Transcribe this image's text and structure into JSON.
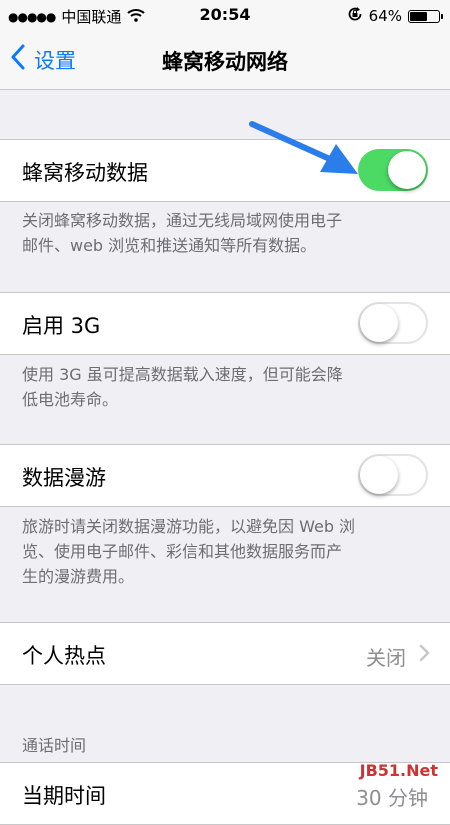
{
  "status_bar": {
    "signal": "●●●●●",
    "carrier": "中国联通",
    "time": "20:54",
    "battery_pct": "64%",
    "battery_level": 0.64
  },
  "nav": {
    "back_label": "设置",
    "title": "蜂窝移动网络"
  },
  "rows": {
    "cellular_data": {
      "label": "蜂窝移动数据",
      "enabled": true,
      "footer_line1": "关闭蜂窝移动数据，通过无线局域网使用电子",
      "footer_line2": "邮件、web 浏览和推送通知等所有数据。"
    },
    "enable_3g": {
      "label": "启用 3G",
      "enabled": false,
      "footer_line1": "使用 3G 虽可提高数据载入速度，但可能会降",
      "footer_line2": "低电池寿命。"
    },
    "data_roaming": {
      "label": "数据漫游",
      "enabled": false,
      "footer_line1": "旅游时请关闭数据漫游功能，以避免因 Web 浏",
      "footer_line2": "览、使用电子邮件、彩信和其他数据服务而产",
      "footer_line3": "生的漫游费用。"
    },
    "hotspot": {
      "label": "个人热点",
      "value": "关闭"
    }
  },
  "call_time": {
    "header": "通话时间",
    "current_period_label": "当期时间",
    "current_period_value": "30 分钟"
  },
  "watermark": "JB51.Net",
  "colors": {
    "accent": "#0a7aff",
    "switch_on": "#4cd964",
    "arrow": "#2b7de9"
  }
}
